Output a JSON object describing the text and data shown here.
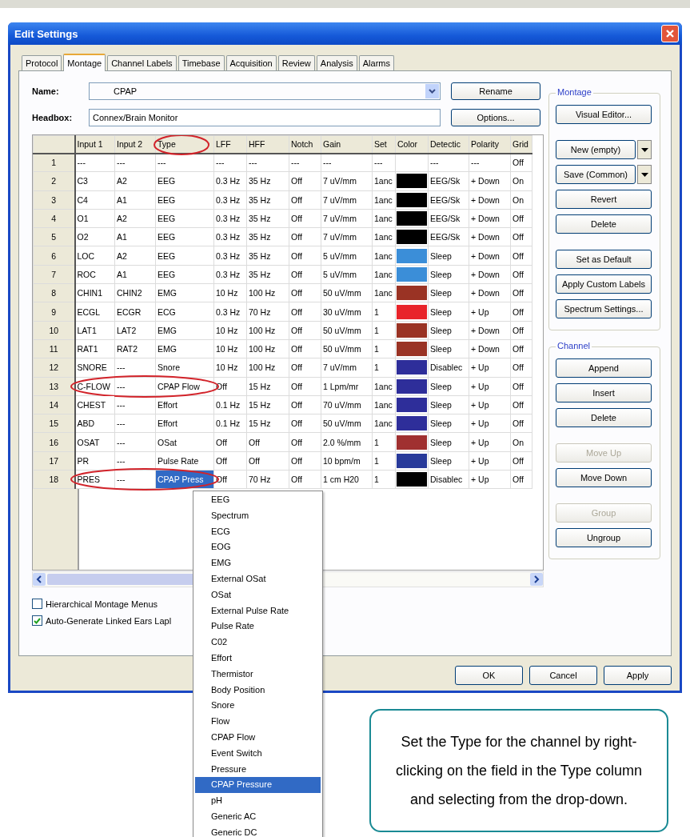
{
  "window": {
    "title": "Edit Settings"
  },
  "tabs": [
    {
      "label": "Protocol",
      "selected": false
    },
    {
      "label": "Montage",
      "selected": true
    },
    {
      "label": "Channel Labels",
      "selected": false
    },
    {
      "label": "Timebase",
      "selected": false
    },
    {
      "label": "Acquisition",
      "selected": false
    },
    {
      "label": "Review",
      "selected": false
    },
    {
      "label": "Analysis",
      "selected": false
    },
    {
      "label": "Alarms",
      "selected": false
    }
  ],
  "name_field": {
    "label": "Name:",
    "value": "CPAP"
  },
  "headbox_field": {
    "label": "Headbox:",
    "value": "Connex/Brain Monitor"
  },
  "rename_button": "Rename",
  "options_button": "Options...",
  "table": {
    "columns": [
      {
        "label": "Input 1",
        "kind": "text",
        "circled": false
      },
      {
        "label": "Input 2",
        "kind": "text",
        "circled": false
      },
      {
        "label": "Type",
        "kind": "text",
        "circled": true
      },
      {
        "label": "LFF",
        "kind": "text",
        "circled": false
      },
      {
        "label": "HFF",
        "kind": "text",
        "circled": false
      },
      {
        "label": "Notch",
        "kind": "text",
        "circled": false
      },
      {
        "label": "Gain",
        "kind": "text",
        "circled": false
      },
      {
        "label": "Set",
        "kind": "text",
        "circled": false
      },
      {
        "label": "Color",
        "kind": "color",
        "circled": false
      },
      {
        "label": "Detectic",
        "kind": "text",
        "circled": false
      },
      {
        "label": "Polarity",
        "kind": "text",
        "circled": false
      },
      {
        "label": "Grid",
        "kind": "text",
        "circled": false
      }
    ],
    "rows": [
      {
        "number": "1",
        "cells": [
          "---",
          "---",
          "---",
          "---",
          "---",
          "---",
          "---",
          "---",
          "",
          "---",
          "---",
          "Off"
        ],
        "circled": false,
        "type_selected": false
      },
      {
        "number": "2",
        "cells": [
          "C3",
          "A2",
          "EEG",
          "0.3 Hz",
          "35 Hz",
          "Off",
          "7 uV/mm",
          "1anc",
          "",
          "EEG/Sk",
          "+ Down",
          "On"
        ],
        "color": "#000000",
        "circled": false,
        "type_selected": false
      },
      {
        "number": "3",
        "cells": [
          "C4",
          "A1",
          "EEG",
          "0.3 Hz",
          "35 Hz",
          "Off",
          "7 uV/mm",
          "1anc",
          "",
          "EEG/Sk",
          "+ Down",
          "On"
        ],
        "color": "#000000",
        "circled": false,
        "type_selected": false
      },
      {
        "number": "4",
        "cells": [
          "O1",
          "A2",
          "EEG",
          "0.3 Hz",
          "35 Hz",
          "Off",
          "7 uV/mm",
          "1anc",
          "",
          "EEG/Sk",
          "+ Down",
          "Off"
        ],
        "color": "#000000",
        "circled": false,
        "type_selected": false
      },
      {
        "number": "5",
        "cells": [
          "O2",
          "A1",
          "EEG",
          "0.3 Hz",
          "35 Hz",
          "Off",
          "7 uV/mm",
          "1anc",
          "",
          "EEG/Sk",
          "+ Down",
          "Off"
        ],
        "color": "#000000",
        "circled": false,
        "type_selected": false
      },
      {
        "number": "6",
        "cells": [
          "LOC",
          "A2",
          "EEG",
          "0.3 Hz",
          "35 Hz",
          "Off",
          "5 uV/mm",
          "1anc",
          "",
          "Sleep",
          "+ Down",
          "Off"
        ],
        "color": "#3b8ed8",
        "circled": false,
        "type_selected": false
      },
      {
        "number": "7",
        "cells": [
          "ROC",
          "A1",
          "EEG",
          "0.3 Hz",
          "35 Hz",
          "Off",
          "5 uV/mm",
          "1anc",
          "",
          "Sleep",
          "+ Down",
          "Off"
        ],
        "color": "#3b8ed8",
        "circled": false,
        "type_selected": false
      },
      {
        "number": "8",
        "cells": [
          "CHIN1",
          "CHIN2",
          "EMG",
          "10 Hz",
          "100 Hz",
          "Off",
          "50 uV/mm",
          "1anc",
          "",
          "Sleep",
          "+ Down",
          "Off"
        ],
        "color": "#9a3324",
        "circled": false,
        "type_selected": false
      },
      {
        "number": "9",
        "cells": [
          "ECGL",
          "ECGR",
          "ECG",
          "0.3 Hz",
          "70 Hz",
          "Off",
          "30 uV/mm",
          "1",
          "",
          "Sleep",
          "+ Up",
          "Off"
        ],
        "color": "#e8242a",
        "circled": false,
        "type_selected": false
      },
      {
        "number": "10",
        "cells": [
          "LAT1",
          "LAT2",
          "EMG",
          "10 Hz",
          "100 Hz",
          "Off",
          "50 uV/mm",
          "1",
          "",
          "Sleep",
          "+ Down",
          "Off"
        ],
        "color": "#9a3324",
        "circled": false,
        "type_selected": false
      },
      {
        "number": "11",
        "cells": [
          "RAT1",
          "RAT2",
          "EMG",
          "10 Hz",
          "100 Hz",
          "Off",
          "50 uV/mm",
          "1",
          "",
          "Sleep",
          "+ Down",
          "Off"
        ],
        "color": "#9a3324",
        "circled": false,
        "type_selected": false
      },
      {
        "number": "12",
        "cells": [
          "SNORE",
          "---",
          "Snore",
          "10 Hz",
          "100 Hz",
          "Off",
          "7 uV/mm",
          "1",
          "",
          "Disablec",
          "+ Up",
          "Off"
        ],
        "color": "#2e2e9a",
        "circled": false,
        "type_selected": false
      },
      {
        "number": "13",
        "cells": [
          "C-FLOW",
          "---",
          "CPAP Flow",
          "Off",
          "15 Hz",
          "Off",
          "1 Lpm/mr",
          "1anc",
          "",
          "Sleep",
          "+ Up",
          "Off"
        ],
        "color": "#2e2e9a",
        "circled": true,
        "type_selected": false
      },
      {
        "number": "14",
        "cells": [
          "CHEST",
          "---",
          "Effort",
          "0.1 Hz",
          "15 Hz",
          "Off",
          "70 uV/mm",
          "1anc",
          "",
          "Sleep",
          "+ Up",
          "Off"
        ],
        "color": "#2e2e9a",
        "circled": false,
        "type_selected": false
      },
      {
        "number": "15",
        "cells": [
          "ABD",
          "---",
          "Effort",
          "0.1 Hz",
          "15 Hz",
          "Off",
          "50 uV/mm",
          "1anc",
          "",
          "Sleep",
          "+ Up",
          "Off"
        ],
        "color": "#2e2e9a",
        "circled": false,
        "type_selected": false
      },
      {
        "number": "16",
        "cells": [
          "OSAT",
          "---",
          "OSat",
          "Off",
          "Off",
          "Off",
          "2.0 %/mm",
          "1",
          "",
          "Sleep",
          "+ Up",
          "On"
        ],
        "color": "#a03030",
        "circled": false,
        "type_selected": false
      },
      {
        "number": "17",
        "cells": [
          "PR",
          "---",
          "Pulse Rate",
          "Off",
          "Off",
          "Off",
          "10 bpm/m",
          "1",
          "",
          "Sleep",
          "+ Up",
          "Off"
        ],
        "color": "#283a9a",
        "circled": false,
        "type_selected": false
      },
      {
        "number": "18",
        "cells": [
          "PRES",
          "---",
          "CPAP Press",
          "Off",
          "70 Hz",
          "Off",
          "1 cm H20",
          "1",
          "",
          "Disablec",
          "+ Up",
          "Off"
        ],
        "color": "#000000",
        "circled": true,
        "type_selected": true
      }
    ]
  },
  "checkboxes": [
    {
      "label": "Hierarchical Montage Menus",
      "checked": false
    },
    {
      "label": "Auto-Generate Linked Ears Lapl",
      "checked": true
    }
  ],
  "groups": [
    {
      "title": "Montage",
      "sections": [
        [
          {
            "label": "Visual Editor...",
            "kind": "button",
            "disabled": false
          }
        ],
        [
          {
            "label": "New (empty)",
            "kind": "split",
            "disabled": false
          },
          {
            "label": "Save (Common)",
            "kind": "split",
            "disabled": false
          },
          {
            "label": "Revert",
            "kind": "button",
            "disabled": false
          },
          {
            "label": "Delete",
            "kind": "button",
            "disabled": false
          }
        ],
        [
          {
            "label": "Set as Default",
            "kind": "button",
            "disabled": false
          },
          {
            "label": "Apply Custom Labels",
            "kind": "button",
            "disabled": false
          },
          {
            "label": "Spectrum Settings...",
            "kind": "button",
            "disabled": false
          }
        ]
      ]
    },
    {
      "title": "Channel",
      "sections": [
        [
          {
            "label": "Append",
            "kind": "button",
            "disabled": false
          },
          {
            "label": "Insert",
            "kind": "button",
            "disabled": false
          },
          {
            "label": "Delete",
            "kind": "button",
            "disabled": false
          }
        ],
        [
          {
            "label": "Move Up",
            "kind": "button",
            "disabled": true
          },
          {
            "label": "Move Down",
            "kind": "button",
            "disabled": false
          }
        ],
        [
          {
            "label": "Group",
            "kind": "button",
            "disabled": true
          },
          {
            "label": "Ungroup",
            "kind": "button",
            "disabled": false
          }
        ]
      ]
    }
  ],
  "footer_buttons": [
    "OK",
    "Cancel",
    "Apply"
  ],
  "dropdown": {
    "items": [
      {
        "label": "EEG",
        "selected": false
      },
      {
        "label": "Spectrum",
        "selected": false
      },
      {
        "label": "ECG",
        "selected": false
      },
      {
        "label": "EOG",
        "selected": false
      },
      {
        "label": "EMG",
        "selected": false
      },
      {
        "label": "External OSat",
        "selected": false
      },
      {
        "label": "OSat",
        "selected": false
      },
      {
        "label": "External Pulse Rate",
        "selected": false
      },
      {
        "label": "Pulse Rate",
        "selected": false
      },
      {
        "label": "C02",
        "selected": false
      },
      {
        "label": "Effort",
        "selected": false
      },
      {
        "label": "Thermistor",
        "selected": false
      },
      {
        "label": "Body Position",
        "selected": false
      },
      {
        "label": "Snore",
        "selected": false
      },
      {
        "label": "Flow",
        "selected": false
      },
      {
        "label": "CPAP Flow",
        "selected": false
      },
      {
        "label": "Event Switch",
        "selected": false
      },
      {
        "label": "Pressure",
        "selected": false
      },
      {
        "label": "CPAP Pressure",
        "selected": true
      },
      {
        "label": "pH",
        "selected": false
      },
      {
        "label": "Generic AC",
        "selected": false
      },
      {
        "label": "Generic DC",
        "selected": false
      }
    ]
  },
  "callout": {
    "text": "Set the Type for the channel by right-clicking on the field in the Type column and selecting from the drop-down."
  }
}
